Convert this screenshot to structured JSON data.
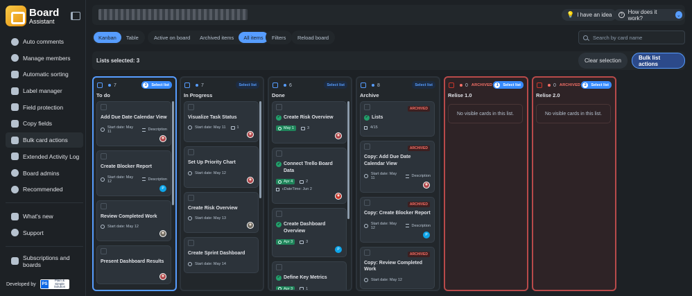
{
  "brand": {
    "name": "Board",
    "sub": "Assistant"
  },
  "sidebar": {
    "items": [
      {
        "label": "Auto comments",
        "icon": "chat-icon",
        "active": false
      },
      {
        "label": "Manage members",
        "icon": "members-icon",
        "active": false
      },
      {
        "label": "Automatic sorting",
        "icon": "sort-icon",
        "active": false
      },
      {
        "label": "Label manager",
        "icon": "label-icon",
        "active": false
      },
      {
        "label": "Field protection",
        "icon": "lock-icon",
        "active": false
      },
      {
        "label": "Copy fields",
        "icon": "copy-icon",
        "active": false
      },
      {
        "label": "Bulk card actions",
        "icon": "bulk-icon",
        "active": true
      },
      {
        "label": "Extended Activity Log",
        "icon": "log-icon",
        "active": false
      },
      {
        "label": "Board admins",
        "icon": "admin-icon",
        "active": false
      },
      {
        "label": "Recommended",
        "icon": "recommended-icon",
        "active": false
      }
    ],
    "secondary": [
      {
        "label": "What's new",
        "icon": "megaphone-icon"
      },
      {
        "label": "Support",
        "icon": "support-icon"
      }
    ],
    "subscriptions": "Subscriptions and boards",
    "developed_by": "Developed by",
    "dev_logo": {
      "mark": "PS",
      "line1": "Plain & Simple",
      "line2": "Solution"
    }
  },
  "header": {
    "idea": "I have an idea",
    "how": "How does it work?"
  },
  "toolbar": {
    "view_tabs": [
      "Kanban",
      "Table"
    ],
    "filter_tabs": [
      "Active on board",
      "Archived items",
      "All items"
    ],
    "filters": "Filters",
    "reload": "Reload board",
    "search_placeholder": "Search by card name"
  },
  "selection": {
    "text": "Lists selected: 3",
    "clear": "Clear selection",
    "bulk": "Bulk list actions"
  },
  "lists": [
    {
      "title": "To do",
      "count": "7",
      "archived": false,
      "selected": true,
      "sel_num": "3",
      "select_label": "Select list",
      "cards": [
        {
          "title": "Add Due Date Calendar View",
          "start": "Start date: May 11",
          "desc": "Description",
          "avatar": "person"
        },
        {
          "title": "Create Blocker Report",
          "start": "Start date: May 12",
          "desc": "Description",
          "avatar": "teal"
        },
        {
          "title": "Review Completed Work",
          "start": "Start date: May 12",
          "avatar": "gray"
        },
        {
          "title": "Present Dashboard Results",
          "avatar": "person"
        }
      ]
    },
    {
      "title": "In Progress",
      "count": "7",
      "archived": false,
      "selected": false,
      "select_label": "Select list",
      "cards": [
        {
          "title": "Visualize Task Status",
          "start": "Start date: May 11",
          "comments": "1",
          "avatar": "person"
        },
        {
          "title": "Set Up Priority Chart",
          "start": "Start date: May 12",
          "avatar": "person"
        },
        {
          "title": "Create Risk Overview",
          "start": "Start date: May 13",
          "avatar": "gray"
        },
        {
          "title": "Create Sprint Dashboard",
          "start": "Start date: May 14"
        }
      ]
    },
    {
      "title": "Done",
      "count": "6",
      "archived": false,
      "selected": false,
      "select_label": "Select list",
      "cards": [
        {
          "title": "Create Risk Overview",
          "done": true,
          "due": "May 1",
          "comments": "3",
          "avatar": "person"
        },
        {
          "title": "Connect Trello Board Data",
          "done": true,
          "due": "Apr 4",
          "comments": "2",
          "custom": "cDateTime: Jun 2",
          "avatar": "red"
        },
        {
          "title": "Create Dashboard Overview",
          "done": true,
          "due": "Apr 3",
          "comments": "3",
          "avatar": "teal"
        },
        {
          "title": "Define Key Metrics",
          "done": true,
          "due": "Apr 3",
          "comments": "1"
        }
      ]
    },
    {
      "title": "Archive",
      "count": "8",
      "archived": false,
      "selected": false,
      "select_label": "Select list",
      "cards": [
        {
          "title": "Lists",
          "done": true,
          "archived": true,
          "checklist": "4/15"
        },
        {
          "title": "Copy: Add Due Date Calendar View",
          "archived": true,
          "start": "Start date: May 11",
          "desc": "Description",
          "avatar": "person"
        },
        {
          "title": "Copy: Create Blocker Report",
          "archived": true,
          "start": "Start date: May 12",
          "desc": "Description",
          "avatar": "teal"
        },
        {
          "title": "Copy: Review Completed Work",
          "archived": true,
          "start": "Start date: May 12"
        }
      ]
    },
    {
      "title": "Relise 1.0",
      "count": "0",
      "archived": true,
      "selected": true,
      "sel_num": "1",
      "select_label": "Select list",
      "empty": "No visible cards in this list."
    },
    {
      "title": "Relise 2.0",
      "count": "0",
      "archived": true,
      "selected": true,
      "sel_num": "2",
      "select_label": "Select list",
      "empty": "No visible cards in this list."
    }
  ],
  "archived_label": "ARCHIVED",
  "colors": {
    "accent": "#579dff",
    "archived": "#f87168",
    "done": "#22a06b"
  }
}
